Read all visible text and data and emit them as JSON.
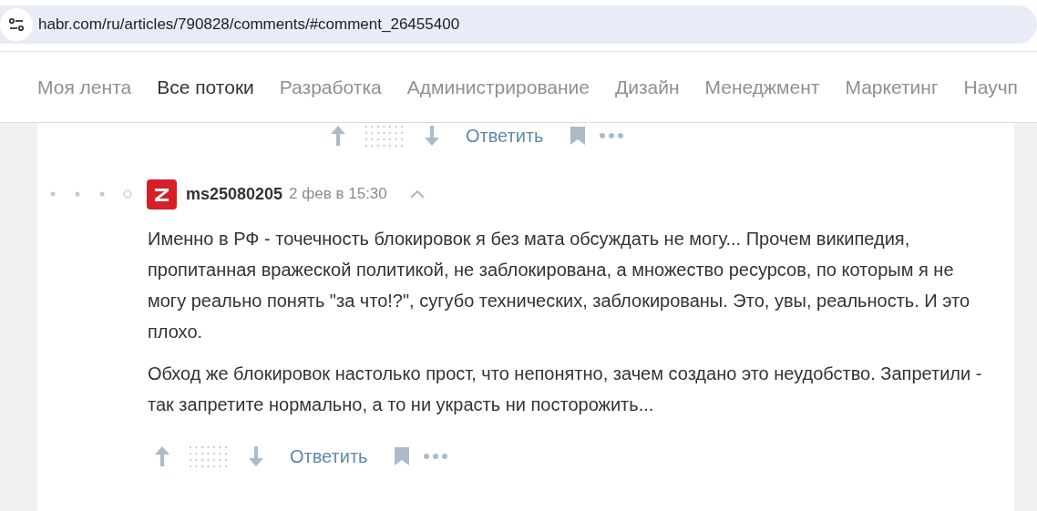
{
  "address_bar": {
    "url": "habr.com/ru/articles/790828/comments/#comment_26455400"
  },
  "nav": {
    "items": [
      {
        "label": "Моя лента",
        "selected": false
      },
      {
        "label": "Все потоки",
        "selected": true
      },
      {
        "label": "Разработка",
        "selected": false
      },
      {
        "label": "Администрирование",
        "selected": false
      },
      {
        "label": "Дизайн",
        "selected": false
      },
      {
        "label": "Менеджмент",
        "selected": false
      },
      {
        "label": "Маркетинг",
        "selected": false
      },
      {
        "label": "Научп",
        "selected": false
      }
    ]
  },
  "parent_actions": {
    "reply": "Ответить"
  },
  "comment": {
    "author": "ms25080205",
    "time": "2 фев в 15:30",
    "paragraphs": [
      "Именно в РФ - точечность блокировок я без мата обсуждать не могу... Прочем википедия, пропитанная вражеской политикой, не заблокирована, а множество ресурсов, по которым я не могу реально понять \"за что!?\", сугубо технических, заблокированы. Это, увы, реальность. И это плохо.",
      "Обход же блокировок настолько прост, что непонятно, зачем создано это неудобство. Запретили - так запретите нормально, а то ни украсть ни посторожить..."
    ],
    "reply": "Ответить"
  }
}
